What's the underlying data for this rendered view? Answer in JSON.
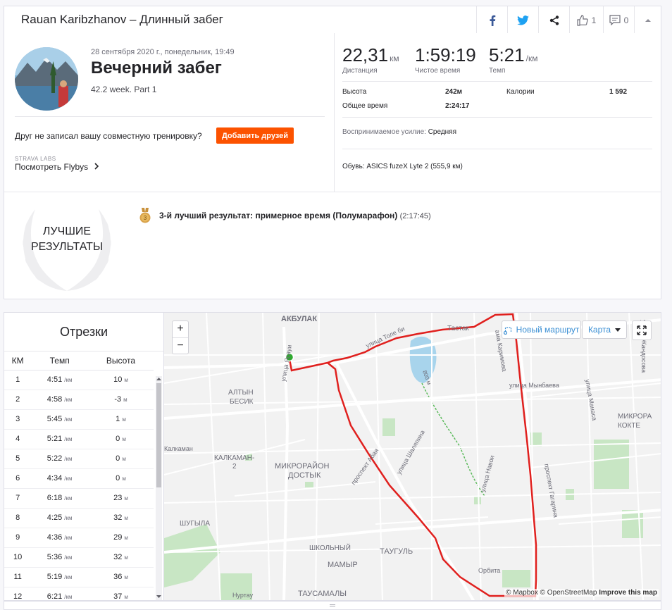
{
  "header": {
    "title": "Rauan Karibzhanov – Длинный забег",
    "kudos_count": "1",
    "comments_count": "0"
  },
  "activity": {
    "date": "28 сентября 2020 г., понедельник, 19:49",
    "name": "Вечерний забег",
    "description": "42.2 week. Part 1",
    "friend_prompt": "Друг не записал вашу совместную тренировку?",
    "add_friends_label": "Добавить друзей",
    "labs_label": "STRAVA LABS",
    "flybys_label": "Посмотреть Flybys"
  },
  "stats": {
    "distance": {
      "value": "22,31",
      "unit": "км",
      "label": "Дистанция"
    },
    "moving_time": {
      "value": "1:59:19",
      "label": "Чистое время"
    },
    "pace": {
      "value": "5:21",
      "unit": "/км",
      "label": "Темп"
    },
    "elevation_label": "Высота",
    "elevation_value": "242м",
    "calories_label": "Калории",
    "calories_value": "1 592",
    "elapsed_label": "Общее время",
    "elapsed_value": "2:24:17",
    "effort_label": "Воспринимаемое усилие:",
    "effort_value": "Средняя",
    "shoes_label": "Обувь:",
    "shoes_value": "ASICS fuzeX Lyte 2 (555,9 км)"
  },
  "best_efforts": {
    "title_line1": "ЛУЧШИЕ",
    "title_line2": "РЕЗУЛЬТАТЫ",
    "medal_rank": "3",
    "line_bold": "3-й лучший результат: примерное время (Полумарафон)",
    "line_time": "(2:17:45)"
  },
  "splits": {
    "title": "Отрезки",
    "columns": [
      "КМ",
      "Темп",
      "Высота"
    ],
    "pace_unit": "/км",
    "elev_unit": "м",
    "rows": [
      {
        "km": "1",
        "pace": "4:51",
        "elev": "10"
      },
      {
        "km": "2",
        "pace": "4:58",
        "elev": "-3"
      },
      {
        "km": "3",
        "pace": "5:45",
        "elev": "1"
      },
      {
        "km": "4",
        "pace": "5:21",
        "elev": "0"
      },
      {
        "km": "5",
        "pace": "5:22",
        "elev": "0"
      },
      {
        "km": "6",
        "pace": "4:34",
        "elev": "0"
      },
      {
        "km": "7",
        "pace": "6:18",
        "elev": "23"
      },
      {
        "km": "8",
        "pace": "4:25",
        "elev": "32"
      },
      {
        "km": "9",
        "pace": "4:36",
        "elev": "29"
      },
      {
        "km": "10",
        "pace": "5:36",
        "elev": "32"
      },
      {
        "km": "11",
        "pace": "5:19",
        "elev": "36"
      },
      {
        "km": "12",
        "pace": "6:21",
        "elev": "37"
      }
    ]
  },
  "map": {
    "new_route_label": "Новый маршрут",
    "map_type_label": "Карта",
    "zoom_in": "+",
    "zoom_out": "−",
    "attribution_mapbox": "© Mapbox",
    "attribution_osm": "© OpenStreetMap",
    "attribution_improve": "Improve this map",
    "labels": [
      {
        "text": "АКБУЛАК"
      },
      {
        "text": "Тастак"
      },
      {
        "text": "АЛТЫН"
      },
      {
        "text": "БЕСИК"
      },
      {
        "text": "Калкаман"
      },
      {
        "text": "КАЛКАМАН-"
      },
      {
        "text": "2"
      },
      {
        "text": "МИКРОРАЙОН"
      },
      {
        "text": "ДОСТЫК"
      },
      {
        "text": "ШУГЫЛА"
      },
      {
        "text": "ШКОЛЬНЫЙ"
      },
      {
        "text": "ТАУГУЛЬ"
      },
      {
        "text": "МАМЫР"
      },
      {
        "text": "ТАУСАМАЛЫ"
      },
      {
        "text": "Нуртау"
      },
      {
        "text": "Орбита"
      },
      {
        "text": "МИКРОРА"
      },
      {
        "text": "КОКТЕ"
      },
      {
        "text": "улица Толе би"
      },
      {
        "text": "улица Ясауи"
      },
      {
        "text": "проспект Абая"
      },
      {
        "text": "улица Шаляпина"
      },
      {
        "text": "улица Навои"
      },
      {
        "text": "проспект Гагарина"
      },
      {
        "text": "улица Манаса"
      },
      {
        "text": "улица Мынбаева"
      },
      {
        "text": "улица Жандосова"
      },
      {
        "text": "ама Каримова"
      },
      {
        "text": "800 м"
      }
    ]
  },
  "colors": {
    "brand": "#fc5200",
    "route": "#e0201e",
    "start": "#2fa82f"
  }
}
